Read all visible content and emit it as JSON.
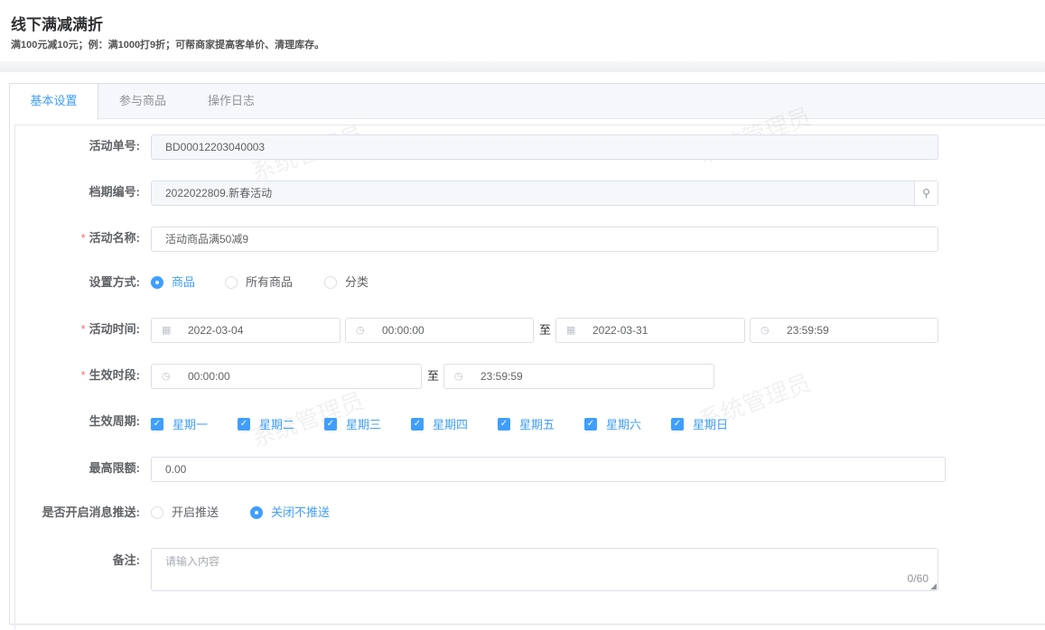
{
  "header": {
    "title": "线下满减满折",
    "subtitle": "满100元减10元；例：满1000打9折；可帮商家提高客单价、清理库存。"
  },
  "tabs": [
    {
      "label": "基本设置"
    },
    {
      "label": "参与商品"
    },
    {
      "label": "操作日志"
    }
  ],
  "watermark": "系统管理员",
  "form": {
    "activity_no": {
      "label": "活动单号:",
      "value": "BD00012203040003"
    },
    "schedule_no": {
      "label": "档期编号:",
      "value": "2022022809.新春活动"
    },
    "activity_name": {
      "label": "活动名称:",
      "value": "活动商品满50减9"
    },
    "setting_mode": {
      "label": "设置方式:",
      "options": [
        "商品",
        "所有商品",
        "分类"
      ],
      "selected": "商品"
    },
    "activity_time": {
      "label": "活动时间:",
      "start_date": "2022-03-04",
      "start_time": "00:00:00",
      "sep": "至",
      "end_date": "2022-03-31",
      "end_time": "23:59:59"
    },
    "effective_period": {
      "label": "生效时段:",
      "start": "00:00:00",
      "sep": "至",
      "end": "23:59:59"
    },
    "weekdays": {
      "label": "生效周期:",
      "items": [
        "星期一",
        "星期二",
        "星期三",
        "星期四",
        "星期五",
        "星期六",
        "星期日"
      ]
    },
    "max_limit": {
      "label": "最高限额:",
      "value": "0.00"
    },
    "push": {
      "label": "是否开启消息推送:",
      "options": [
        "开启推送",
        "关闭不推送"
      ],
      "selected": "关闭不推送"
    },
    "remark": {
      "label": "备注:",
      "placeholder": "请输入内容",
      "counter": "0/60"
    }
  }
}
